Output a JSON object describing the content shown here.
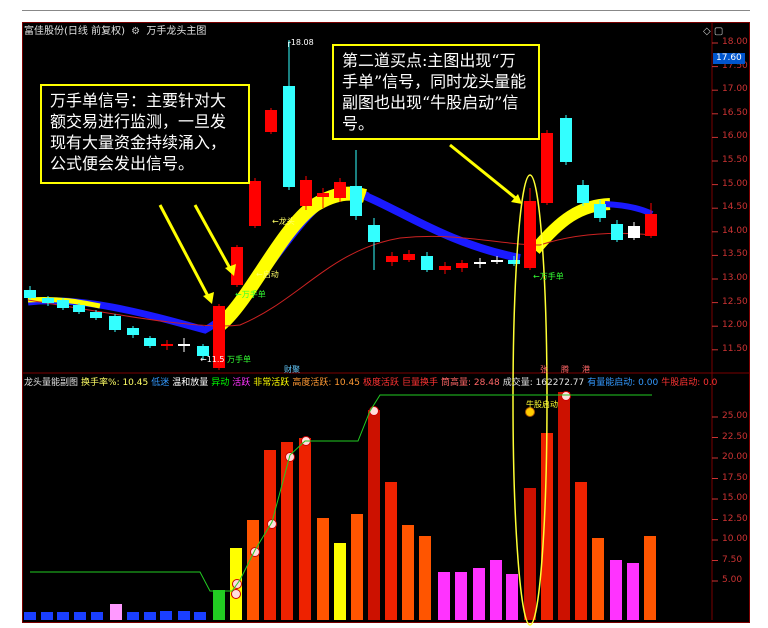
{
  "title_bar": {
    "stock": "富佳股份(日线 前复权)",
    "indicator": "万手龙头主图",
    "window_controls": "◇ ▢"
  },
  "price_axis": {
    "ticks": [
      "18.00",
      "17.50",
      "17.00",
      "16.50",
      "16.00",
      "15.50",
      "15.00",
      "14.50",
      "14.00",
      "13.50",
      "13.00",
      "12.50",
      "12.00",
      "11.50"
    ],
    "current_price": "17.60"
  },
  "main_chart_labels": {
    "high_label": "18.08",
    "low_label": "11.5",
    "wanshou_1": "万手单",
    "wanshou_2": "万手单",
    "longtou": "龙头",
    "qidong": "启动",
    "wanshou_3": "万手单",
    "caijing": "财聚"
  },
  "callouts": {
    "left": "万手单信号：主要针对大额交易进行监测，一旦发现有大量资金持续涌入，公式便会发出信号。",
    "right": "第二道买点:主图出现“万手单”信号，同时龙头量能副图也出现“牛股启动”信号。"
  },
  "sub_legend": [
    {
      "text": "龙头量能副图",
      "color": "#e0e0e0"
    },
    {
      "text": "换手率%: 10.45",
      "color": "#ffff66"
    },
    {
      "text": "低迷",
      "color": "#3399ff"
    },
    {
      "text": "温和放量",
      "color": "#ffffff"
    },
    {
      "text": "异动",
      "color": "#00ff00"
    },
    {
      "text": "活跃",
      "color": "#ff33ff"
    },
    {
      "text": "非常活跃",
      "color": "#ffff00"
    },
    {
      "text": "高度活跃: 10.45",
      "color": "#ff9933"
    },
    {
      "text": "极度活跃",
      "color": "#ff3333"
    },
    {
      "text": "巨量换手",
      "color": "#ff3333"
    },
    {
      "text": "筒高量: 28.48",
      "color": "#ff6666"
    },
    {
      "text": "成交量: 162272.77",
      "color": "#e0e0e0"
    },
    {
      "text": "有量能启动: 0.00",
      "color": "#3399ff"
    },
    {
      "text": "牛股启动: 0.0",
      "color": "#ff3333"
    }
  ],
  "sub_axis": {
    "ticks": [
      "25.00",
      "22.50",
      "20.00",
      "17.50",
      "15.00",
      "12.50",
      "10.00",
      "7.50",
      "5.00"
    ]
  },
  "sub_markers": {
    "niugu": "牛股启动",
    "zhang1": "张",
    "teng": "腾",
    "gang": "港"
  },
  "colors": {
    "ma_yellow": "#ffff00",
    "ma_blue": "#1a1aff",
    "up_candle": "#ff0000",
    "down_candle": "#33ffff",
    "ellipse": "#ffff33"
  }
}
